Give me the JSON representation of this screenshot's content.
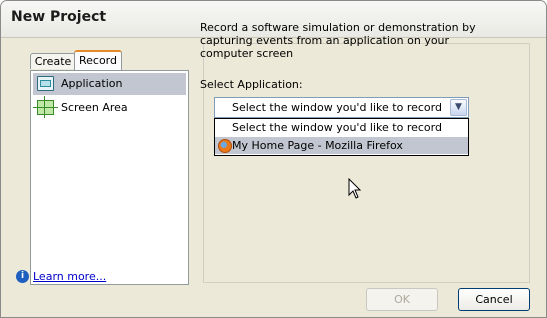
{
  "window": {
    "title": "New Project"
  },
  "tabs": [
    {
      "label": "Create"
    },
    {
      "label": "Record"
    }
  ],
  "sidebar": {
    "items": [
      {
        "label": "Application",
        "icon": "application-icon",
        "selected": true
      },
      {
        "label": "Screen Area",
        "icon": "screen-area-icon",
        "selected": false
      }
    ]
  },
  "main": {
    "description": "Record a software simulation or demonstration by capturing events from an application on your computer screen",
    "select_label": "Select Application:",
    "combo_value": "Select the window you'd like to record",
    "dropdown_options": [
      {
        "label": "Select the window you'd like to record"
      },
      {
        "label": "My Home Page - Mozilla Firefox",
        "icon": "firefox-icon"
      }
    ]
  },
  "footer": {
    "learn_more": "Learn more...",
    "ok_label": "OK",
    "cancel_label": "Cancel"
  },
  "colors": {
    "selection": "#c1c6d0",
    "dialog_bg": "#ece9d8",
    "link": "#0000cc",
    "tab_accent": "#e68b2c"
  }
}
